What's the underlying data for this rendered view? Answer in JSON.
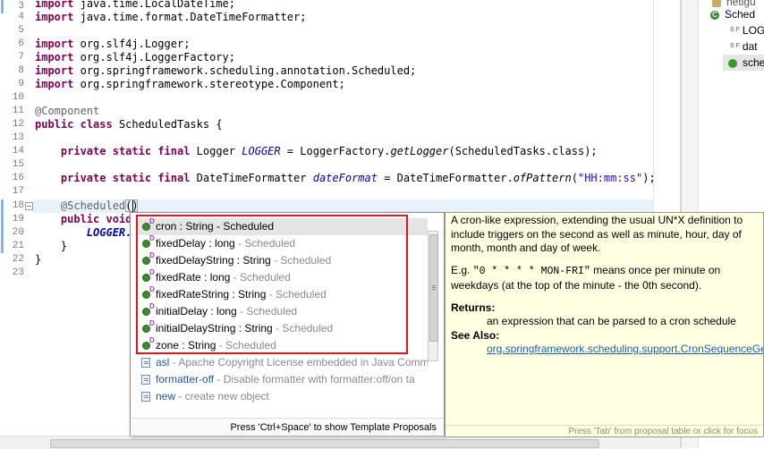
{
  "editor": {
    "line_numbers": [
      "3",
      "4",
      "5",
      "6",
      "7",
      "8",
      "9",
      "10",
      "11",
      "12",
      "13",
      "14",
      "15",
      "16",
      "17",
      "18",
      "19",
      "20",
      "21",
      "22",
      "23"
    ],
    "imports": [
      "java.time.LocalDateTime;",
      "java.time.format.DateTimeFormatter;",
      "org.slf4j.Logger;",
      "org.slf4j.LoggerFactory;",
      "org.springframework.scheduling.annotation.Scheduled;",
      "org.springframework.stereotype.Component;"
    ],
    "kw_import": "import",
    "kw_public": "public",
    "kw_class": "class",
    "kw_private": "private",
    "kw_static": "static",
    "kw_final": "final",
    "kw_void": "void",
    "component_annotation": "@Component",
    "class_name": " ScheduledTasks {",
    "logger_type": "Logger",
    "logger_field": "LOGGER",
    "logger_init_a": " = LoggerFactory.",
    "logger_init_method": "getLogger",
    "logger_init_b": "(ScheduledTasks.class);",
    "dtf_type": "DateTimeFormatter",
    "dtf_field": "dateFormat",
    "dtf_init_a": " = DateTimeFormatter.",
    "dtf_init_method": "ofPattern",
    "dtf_init_b": "(",
    "dtf_pattern": "\"HH:mm:ss\"",
    "dtf_init_c": ");",
    "scheduled_annotation": "@Scheduled",
    "scheduled_paren": "()",
    "line19_tail": "",
    "line20_field": "LOGGER.",
    "close_inner": "}",
    "close_outer": "}"
  },
  "completion": {
    "proposals": [
      {
        "name": "cron : String",
        "qualifier": " - Scheduled"
      },
      {
        "name": "fixedDelay : long",
        "qualifier": " - Scheduled"
      },
      {
        "name": "fixedDelayString : String",
        "qualifier": " - Scheduled"
      },
      {
        "name": "fixedRate : long",
        "qualifier": " - Scheduled"
      },
      {
        "name": "fixedRateString : String",
        "qualifier": " - Scheduled"
      },
      {
        "name": "initialDelay : long",
        "qualifier": " - Scheduled"
      },
      {
        "name": "initialDelayString : String",
        "qualifier": " - Scheduled"
      },
      {
        "name": "zone : String",
        "qualifier": " - Scheduled"
      }
    ],
    "templates": [
      {
        "name": "asl",
        "desc": " - Apache Copyright License embedded in Java Comm"
      },
      {
        "name": "formatter-off",
        "desc": " - Disable formatter with formatter:off/on ta"
      },
      {
        "name": "new",
        "desc": " - create new object"
      }
    ],
    "footer": "Press 'Ctrl+Space' to show Template Proposals"
  },
  "javadoc": {
    "para1": "A cron-like expression, extending the usual UN*X definition to include triggers on the second as well as minute, hour, day of month, month and day of week.",
    "para2_prefix": "E.g. ",
    "para2_code": "\"0 * * * * MON-FRI\"",
    "para2_suffix": " means once per minute on weekdays (at the top of the minute - the 0th second).",
    "returns_label": "Returns:",
    "returns_text": "an expression that can be parsed to a cron schedule",
    "see_also_label": "See Also:",
    "see_also_link": "org.springframework.scheduling.support.CronSequenceGe",
    "footer": "Press 'Tab' from proposal table or click for focus"
  },
  "outline": {
    "items": [
      {
        "label": "netigu"
      },
      {
        "label": "Sched"
      },
      {
        "label": "LOG"
      },
      {
        "label": "dat"
      },
      {
        "label": "sche"
      }
    ],
    "superscript_sf": "S F",
    "class_badge": "C"
  },
  "colors": {
    "keyword": "#7f0055",
    "annotation": "#646464",
    "static_field": "#0000c0",
    "string": "#2a00ff",
    "highlight_box": "#e0161f",
    "javadoc_bg": "#ffffe1"
  }
}
